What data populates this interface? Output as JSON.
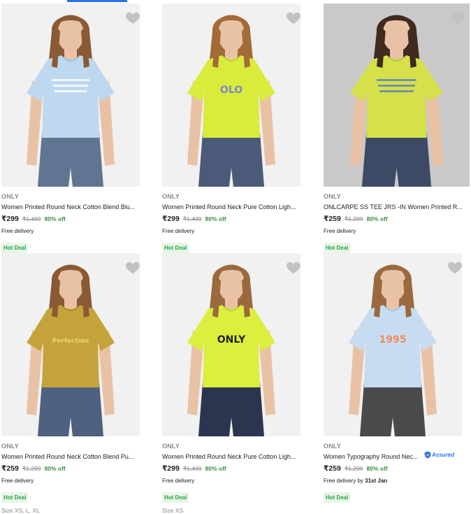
{
  "products": [
    {
      "brand": "ONLY",
      "title": "Women Printed Round Neck Cotton Blend Blu...",
      "price": "₹299",
      "mrp": "₹1,499",
      "discount": "80% off",
      "delivery": "Free delivery",
      "deal": "Hot Deal",
      "tee_color": "#bed8f0",
      "bg": "#f1f1f1",
      "shorts": "#5f7591",
      "hair": "#8a5a34",
      "print_text": "",
      "print_color": "#ffffff"
    },
    {
      "brand": "ONLY",
      "title": "Women Printed Round Neck Pure Cotton Ligh...",
      "price": "₹299",
      "mrp": "₹1,499",
      "discount": "80% off",
      "delivery": "Free delivery",
      "deal": "Hot Deal",
      "tee_color": "#d9ec3c",
      "bg": "#f1f1f1",
      "shorts": "#4b5a78",
      "hair": "#a36b37",
      "print_text": "OLO",
      "print_color": "#7b84c9"
    },
    {
      "brand": "ONLY",
      "title": "ONLCARPE SS TEE JRS -IN Women Printed R...",
      "price": "₹259",
      "mrp": "₹1,299",
      "discount": "80% off",
      "delivery": "Free delivery",
      "deal": "Hot Deal",
      "tee_color": "#d5e04a",
      "bg": "#c9c9c9",
      "shorts": "#3c4a66",
      "hair": "#3e2a1f",
      "print_text": "",
      "print_color": "#5b7fc2"
    },
    {
      "brand": "ONLY",
      "title": "Women Printed Round Neck Cotton Blend Pu...",
      "price": "₹259",
      "mrp": "₹1,299",
      "discount": "80% off",
      "delivery": "Free delivery",
      "deal": "Hot Deal",
      "size": "Size XS, L, XL",
      "tee_color": "#c4a33a",
      "bg": "#f1f1f1",
      "shorts": "#4f6180",
      "hair": "#8a5a34",
      "print_text": "Perfection",
      "print_color": "#f1d46a"
    },
    {
      "brand": "ONLY",
      "title": "Women Printed Round Neck Pure Cotton Ligh...",
      "price": "₹299",
      "mrp": "₹1,499",
      "discount": "80% off",
      "delivery": "Free delivery",
      "deal": "Hot Deal",
      "size": "Size XS",
      "tee_color": "#dcee3e",
      "bg": "#f1f1f1",
      "shorts": "#2c3550",
      "hair": "#9a6a3e",
      "print_text": "ONLY",
      "print_color": "#222222"
    },
    {
      "brand": "ONLY",
      "title": "Women Typography Round Nec...",
      "assured": "Assured",
      "price": "₹259",
      "mrp": "₹1,299",
      "discount": "80% off",
      "delivery": "Free delivery by ",
      "delivery_date": "31st Jan",
      "deal": "Hot Deal",
      "tee_color": "#c7dcf1",
      "bg": "#f1f1f1",
      "shorts": "#4a4a4a",
      "hair": "#9a6a3e",
      "print_text": "1995",
      "print_color": "#f08c5a"
    }
  ],
  "icons": {
    "wishlist": "heart-icon",
    "assured": "shield-icon"
  }
}
